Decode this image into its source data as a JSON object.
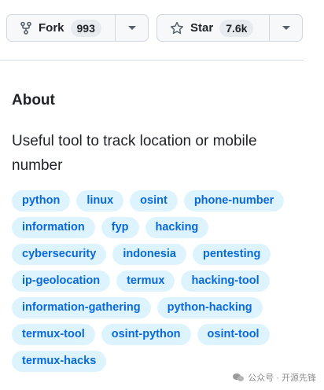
{
  "fork": {
    "label": "Fork",
    "count": "993"
  },
  "star": {
    "label": "Star",
    "count": "7.6k"
  },
  "about": {
    "title": "About",
    "description": "Useful tool to track location or mobile number"
  },
  "topics": [
    "python",
    "linux",
    "osint",
    "phone-number",
    "information",
    "fyp",
    "hacking",
    "cybersecurity",
    "indonesia",
    "pentesting",
    "ip-geolocation",
    "termux",
    "hacking-tool",
    "information-gathering",
    "python-hacking",
    "termux-tool",
    "osint-python",
    "osint-tool",
    "termux-hacks"
  ],
  "watermark": {
    "text": "公众号 · 开源先锋"
  },
  "colors": {
    "topic_bg": "#ddf4ff",
    "topic_text": "#0969da",
    "button_bg": "#f6f8fa"
  }
}
